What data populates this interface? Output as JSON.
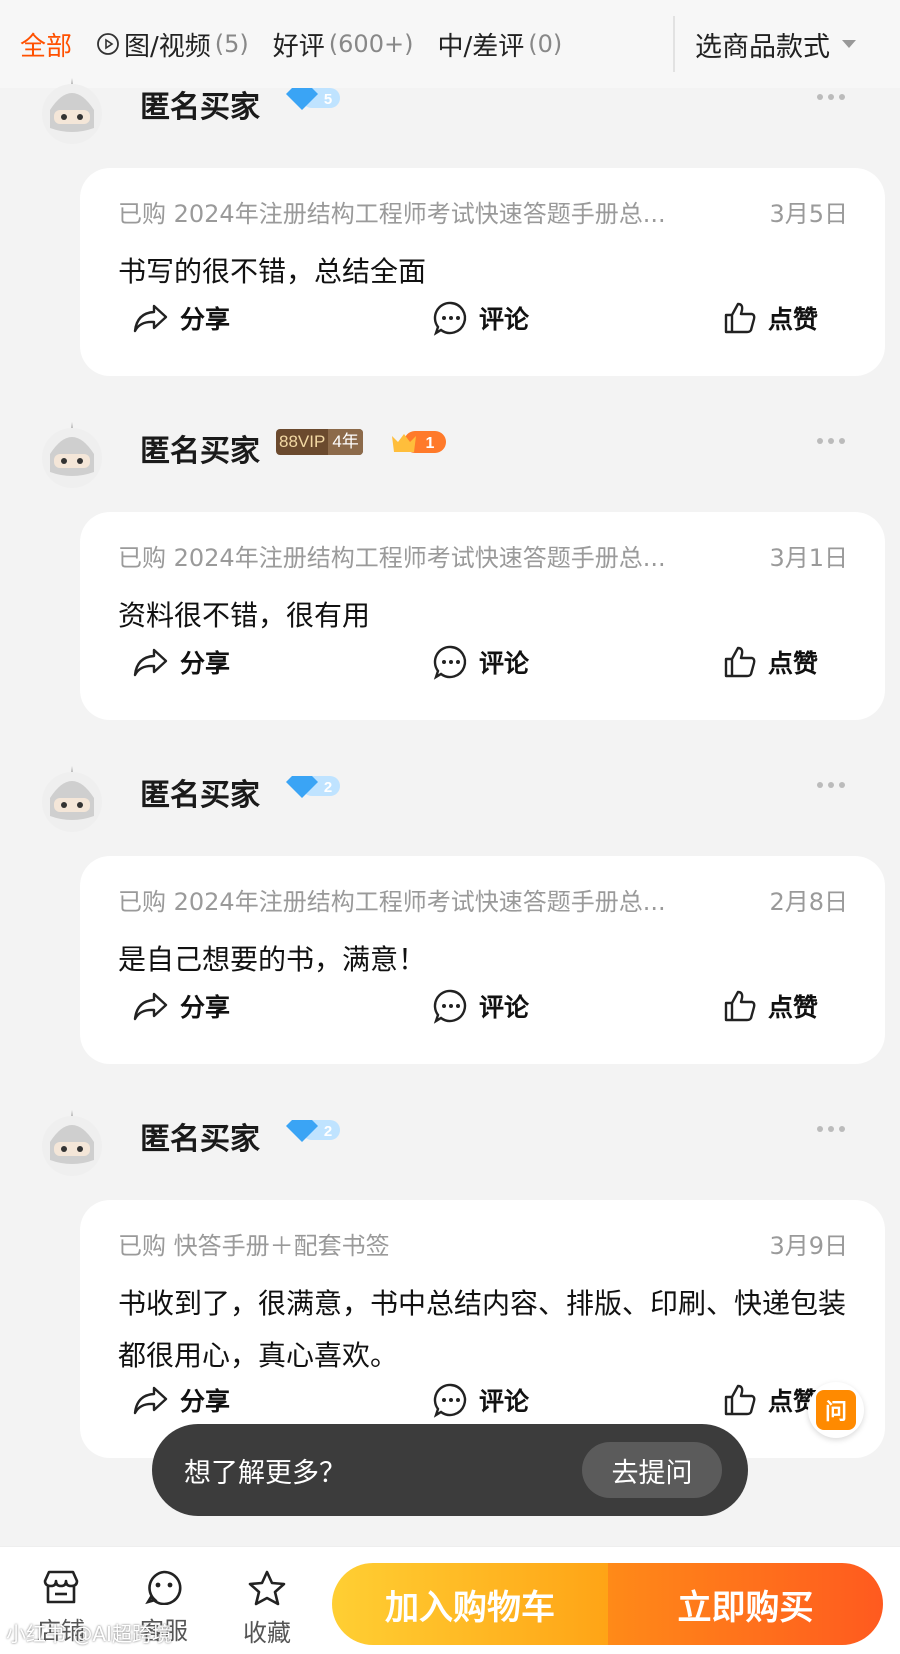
{
  "tabs": [
    {
      "label": "全部",
      "count": "",
      "active": true
    },
    {
      "label": "图/视频",
      "count": "(5)",
      "active": false
    },
    {
      "label": "好评",
      "count": "(600+)",
      "active": false
    },
    {
      "label": "中/差评",
      "count": "(0)",
      "active": false
    }
  ],
  "style_selector": {
    "label": "选商品款式"
  },
  "reviews": [
    {
      "name": "匿名买家",
      "badge": {
        "type": "diamond",
        "level": "5"
      },
      "product": "已购 2024年注册结构工程师考试快速答题手册总...",
      "date": "3月5日",
      "content": "书写的很不错，总结全面"
    },
    {
      "name": "匿名买家",
      "badge": {
        "type": "vip",
        "vip_text": "88VIP",
        "years": "4年",
        "crown_level": "1"
      },
      "product": "已购 2024年注册结构工程师考试快速答题手册总...",
      "date": "3月1日",
      "content": "资料很不错，很有用"
    },
    {
      "name": "匿名买家",
      "badge": {
        "type": "diamond",
        "level": "2"
      },
      "product": "已购 2024年注册结构工程师考试快速答题手册总...",
      "date": "2月8日",
      "content": "是自己想要的书，满意！"
    },
    {
      "name": "匿名买家",
      "badge": {
        "type": "diamond",
        "level": "2"
      },
      "product": "已购 快答手册＋配套书签",
      "date": "3月9日",
      "content": "书收到了，很满意，书中总结内容、排版、印刷、快递包装都很用心，真心喜欢。"
    }
  ],
  "actions": {
    "share": "分享",
    "comment": "评论",
    "like": "点赞"
  },
  "floating_ask": {
    "label": "问"
  },
  "ask_bar": {
    "text": "想了解更多？",
    "button": "去提问"
  },
  "bottom_nav": {
    "store": "店铺",
    "service": "客服",
    "favorite": "收藏",
    "add_to_cart": "加入购物车",
    "buy_now": "立即购买"
  },
  "watermark": "小红书 @AI超跨境",
  "colors": {
    "accent": "#ff5000",
    "cart": "#ffb020",
    "buy": "#ff6a1a"
  }
}
